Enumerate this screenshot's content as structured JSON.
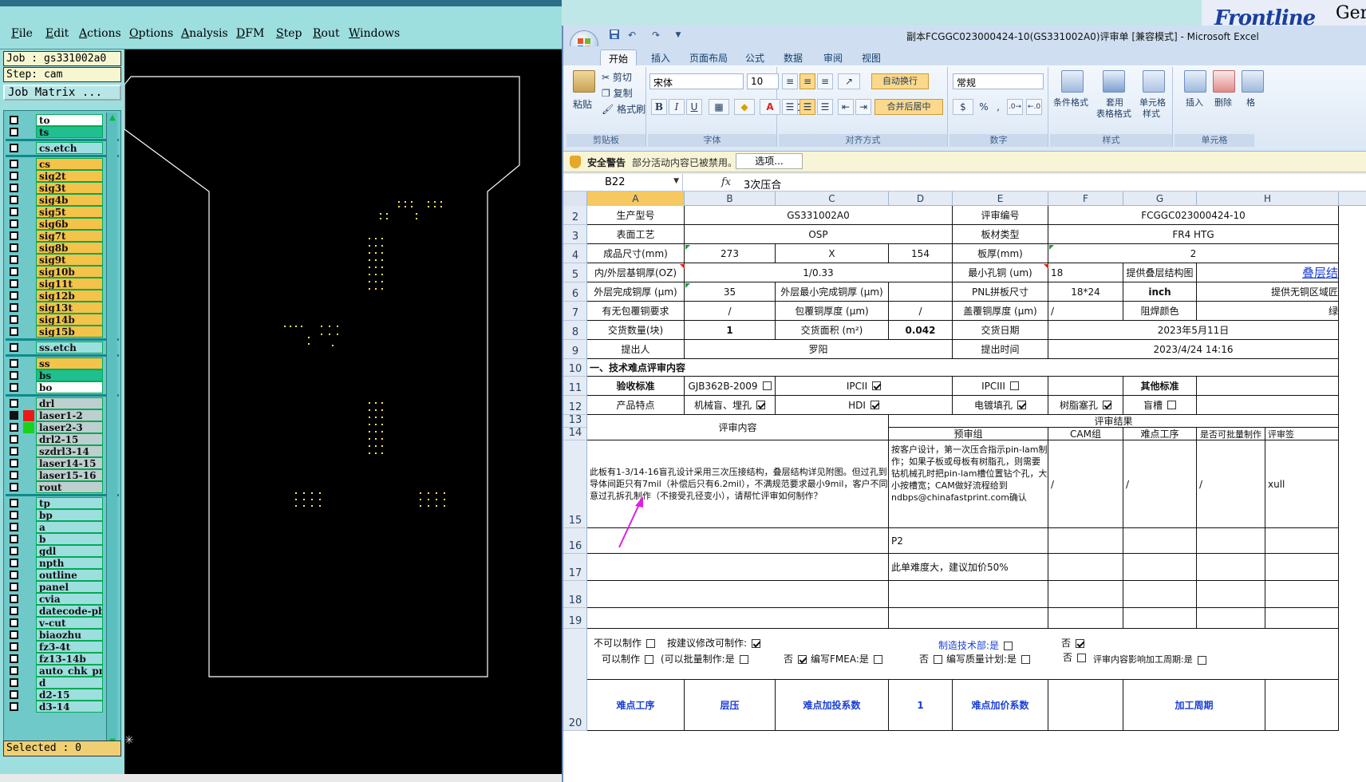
{
  "cam": {
    "menus": [
      {
        "label": "File"
      },
      {
        "label": "Edit"
      },
      {
        "label": "Actions"
      },
      {
        "label": "Options"
      },
      {
        "label": "Analysis"
      },
      {
        "label": "DFM"
      },
      {
        "label": "Step"
      },
      {
        "label": "Rout"
      },
      {
        "label": "Windows"
      }
    ],
    "job_line": "Job : gs331002a0",
    "step_line": "Step: cam",
    "job_matrix_button": "Job Matrix ...",
    "selected": "Selected : 0",
    "layers": [
      {
        "name": "to",
        "color": "#ffffff",
        "check": "on"
      },
      {
        "name": "ts",
        "color": "#1fbf8f",
        "check": "on"
      },
      {
        "name": "cs.etch",
        "color": "#9ddede",
        "check": "on"
      },
      {
        "name": "cs",
        "color": "#f5c24a",
        "check": "on"
      },
      {
        "name": "sig2t",
        "color": "#f5c24a",
        "check": "on"
      },
      {
        "name": "sig3t",
        "color": "#f5c24a",
        "check": "on"
      },
      {
        "name": "sig4b",
        "color": "#f5c24a",
        "check": "on"
      },
      {
        "name": "sig5t",
        "color": "#f5c24a",
        "check": "on"
      },
      {
        "name": "sig6b",
        "color": "#f5c24a",
        "check": "on"
      },
      {
        "name": "sig7t",
        "color": "#f5c24a",
        "check": "on"
      },
      {
        "name": "sig8b",
        "color": "#f5c24a",
        "check": "on"
      },
      {
        "name": "sig9t",
        "color": "#f5c24a",
        "check": "on"
      },
      {
        "name": "sig10b",
        "color": "#f5c24a",
        "check": "on"
      },
      {
        "name": "sig11t",
        "color": "#f5c24a",
        "check": "on"
      },
      {
        "name": "sig12b",
        "color": "#f5c24a",
        "check": "on"
      },
      {
        "name": "sig13t",
        "color": "#f5c24a",
        "check": "on"
      },
      {
        "name": "sig14b",
        "color": "#f5c24a",
        "check": "on"
      },
      {
        "name": "sig15b",
        "color": "#f5c24a",
        "check": "on"
      },
      {
        "name": "ss.etch",
        "color": "#9ddede",
        "check": "on"
      },
      {
        "name": "ss",
        "color": "#f5c24a",
        "check": "on"
      },
      {
        "name": "bs",
        "color": "#1fbf8f",
        "check": "on"
      },
      {
        "name": "bo",
        "color": "#ffffff",
        "check": "on"
      },
      {
        "name": "drl",
        "color": "#bfcfcf",
        "check": "on"
      },
      {
        "name": "laser1-2",
        "color": "#bfcfcf",
        "check": "sel",
        "swatch": "#e81a1a"
      },
      {
        "name": "laser2-3",
        "color": "#bfcfcf",
        "check": "on",
        "swatch": "#1ad21a"
      },
      {
        "name": "drl2-15",
        "color": "#bfcfcf",
        "check": "on"
      },
      {
        "name": "szdrl3-14",
        "color": "#bfcfcf",
        "check": "on"
      },
      {
        "name": "laser14-15",
        "color": "#bfcfcf",
        "check": "on"
      },
      {
        "name": "laser15-16",
        "color": "#bfcfcf",
        "check": "on"
      },
      {
        "name": "rout",
        "color": "#bfcfcf",
        "check": "on"
      },
      {
        "name": "tp",
        "color": "#9ddede",
        "check": "on"
      },
      {
        "name": "bp",
        "color": "#9ddede",
        "check": "on"
      },
      {
        "name": "a",
        "color": "#9ddede",
        "check": "on"
      },
      {
        "name": "b",
        "color": "#9ddede",
        "check": "on"
      },
      {
        "name": "gdl",
        "color": "#9ddede",
        "check": "on"
      },
      {
        "name": "npth",
        "color": "#9ddede",
        "check": "on"
      },
      {
        "name": "outline",
        "color": "#9ddede",
        "check": "on"
      },
      {
        "name": "panel",
        "color": "#9ddede",
        "check": "on"
      },
      {
        "name": "cvia",
        "color": "#9ddede",
        "check": "on"
      },
      {
        "name": "datecode-pbo",
        "color": "#9ddede",
        "check": "on"
      },
      {
        "name": "v-cut",
        "color": "#9ddede",
        "check": "on"
      },
      {
        "name": "biaozhu",
        "color": "#9ddede",
        "check": "on"
      },
      {
        "name": "fz3-4t",
        "color": "#9ddede",
        "check": "on"
      },
      {
        "name": "fz13-14b",
        "color": "#9ddede",
        "check": "on"
      },
      {
        "name": "auto_chk_pn",
        "color": "#9ddede",
        "check": "on"
      },
      {
        "name": "d",
        "color": "#9ddede",
        "check": "on"
      },
      {
        "name": "d2-15",
        "color": "#9ddede",
        "check": "on"
      },
      {
        "name": "d3-14",
        "color": "#9ddede",
        "check": "on"
      }
    ]
  },
  "brand": {
    "text": "Frontline",
    "right_text": "Ger"
  },
  "excel": {
    "title": "副本FCGGC023000424-10(GS331002A0)评审单 [兼容模式] - Microsoft Excel",
    "tabs": [
      "开始",
      "插入",
      "页面布局",
      "公式",
      "数据",
      "审阅",
      "视图"
    ],
    "clipboard": {
      "paste": "粘贴",
      "cut": "剪切",
      "copy": "复制",
      "format_painter": "格式刷",
      "label": "剪贴板"
    },
    "font": {
      "name": "宋体",
      "size": "10",
      "label": "字体"
    },
    "alignment": {
      "wrap": "自动换行",
      "merge": "合并后居中",
      "label": "对齐方式"
    },
    "number": {
      "format": "常规",
      "label": "数字"
    },
    "styles": {
      "conditional": "条件格式",
      "table1": "套用",
      "table2": "表格格式",
      "cell1": "单元格",
      "cell2": "样式",
      "label": "样式"
    },
    "cells": {
      "insert": "插入",
      "delete": "删除",
      "format": "格",
      "label": "单元格"
    },
    "security": {
      "title": "安全警告",
      "message": "部分活动内容已被禁用。",
      "button": "选项..."
    },
    "namebox": "B22",
    "formula": "3次压合",
    "columns": [
      "A",
      "B",
      "C",
      "D",
      "E",
      "F",
      "G",
      "H"
    ],
    "rows": [
      "2",
      "3",
      "4",
      "5",
      "6",
      "7",
      "8",
      "9",
      "10",
      "11",
      "12",
      "13",
      "14",
      "15",
      "16",
      "17",
      "18",
      "19",
      "20"
    ],
    "cells_data": {
      "r2": {
        "a": "生产型号",
        "bc": "GS331002A0",
        "e": "评审编号",
        "fh": "FCGGC023000424-10"
      },
      "r3": {
        "a": "表面工艺",
        "bc": "OSP",
        "e": "板材类型",
        "fh": "FR4 HTG"
      },
      "r4": {
        "a": "成品尺寸(mm)",
        "b": "273",
        "c": "X",
        "d": "154",
        "e": "板厚(mm)",
        "fh": "2"
      },
      "r5": {
        "a": "内/外层基铜厚(OZ)",
        "bc": "1/0.33",
        "e": "最小孔铜 (um)",
        "f": "18",
        "g": "提供叠层结构图",
        "h": "叠层结"
      },
      "r6": {
        "a": "外层完成铜厚 (μm)",
        "b": "35",
        "c": "外层最小完成铜厚 (μm)",
        "e": "PNL拼板尺寸",
        "f": "18*24",
        "g": "inch",
        "h": "提供无铜区域匠"
      },
      "r7": {
        "a": "有无包覆铜要求",
        "b": "/",
        "c": "包覆铜厚度 (μm)",
        "d": "/",
        "e": "盖覆铜厚度 (μm)",
        "f": "/",
        "g": "阻焊颜色",
        "h": "绿"
      },
      "r8": {
        "a": "交货数量(块)",
        "b": "1",
        "c": "交货面积 (m²)",
        "d": "0.042",
        "e": "交货日期",
        "fh": "2023年5月11日"
      },
      "r9": {
        "a": "提出人",
        "bc": "罗阳",
        "e": "提出时间",
        "fh": "2023/4/24 14:16"
      },
      "r10": {
        "a": "一、技术难点评审内容"
      },
      "r11": {
        "a": "验收标准",
        "b": "GJB362B-2009",
        "c": "IPCII",
        "e": "IPCIII",
        "g": "其他标准"
      },
      "r12": {
        "a": "产品特点",
        "b": "机械盲、埋孔",
        "c": "HDI",
        "e": "电镀填孔",
        "f": "树脂塞孔",
        "g": "盲槽"
      },
      "r13": {
        "result": "评审结果"
      },
      "r14": {
        "content": "评审内容",
        "pre": "预审组",
        "cam": "CAM组",
        "proc": "难点工序",
        "batch": "是否可批量制作",
        "sign": "评审签"
      },
      "r15": {
        "content": "此板有1-3/14-16盲孔设计采用三次压接结构，叠层结构详见附图。但过孔到导体间距只有7mil（补偿后只有6.2mil），不满规范要求最小9mil，客户不同意过孔拆孔制作（不接受孔径变小），请帮忙评审如何制作？",
        "pre": "按客户设计，第一次压合指示pin-lam制作；如果子板或母板有树脂孔，则需要钻机械孔时把pin-lam槽位置钻个孔，大小按槽宽；CAM做好流程给到ndbps@chinafastprint.com确认",
        "f": "/",
        "g": "/",
        "h": "/",
        "i": "xull"
      },
      "r16": {
        "pre": "P2"
      },
      "r17": {
        "pre": "此单难度大，建议加价50%"
      },
      "r20": {
        "cannot": "不可以制作",
        "suggest": "按建议修改可制作:",
        "tech": "制造技术部:是",
        "no1": "否",
        "can": "可以制作",
        "batch": "(可以批量制作:是",
        "no2": "否",
        "fmea": "编写FMEA:是",
        "no3": "否",
        "quality": "编写质量计划:是",
        "no4": "否",
        "impact": "评审内容影响加工周期:是",
        "proc": "难点工序",
        "press": "层压",
        "coef": "难点加投系数",
        "one": "1",
        "price": "难点加价系数",
        "cycle": "加工周期"
      }
    }
  }
}
